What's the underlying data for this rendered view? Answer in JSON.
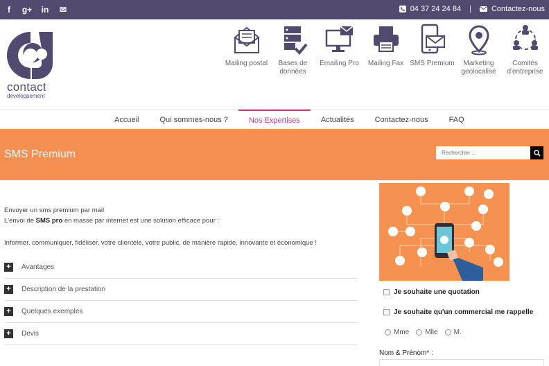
{
  "topbar": {
    "social": [
      {
        "icon": "facebook-icon",
        "glyph": "f"
      },
      {
        "icon": "google-plus-icon",
        "glyph": "g+"
      },
      {
        "icon": "linkedin-icon",
        "glyph": "in"
      },
      {
        "icon": "mail-icon",
        "glyph": "✉"
      }
    ],
    "phone": "04 37 24 24 84",
    "separator": "|",
    "contact_link": "Contactez-nous"
  },
  "logo": {
    "word": "contact",
    "sub": "développement"
  },
  "services": [
    {
      "label": "Mailing postal",
      "icon": "envelope-open-icon"
    },
    {
      "label": "Bases de données",
      "icon": "database-check-icon"
    },
    {
      "label": "Emailing Pro",
      "icon": "monitor-mail-icon"
    },
    {
      "label": "Mailing Fax",
      "icon": "printer-icon"
    },
    {
      "label": "SMS Premium",
      "icon": "phone-mail-icon"
    },
    {
      "label": "Marketing geolocalisé",
      "icon": "map-pin-icon"
    },
    {
      "label": "Comités d'entreprise",
      "icon": "people-network-icon"
    }
  ],
  "nav": [
    "Accueil",
    "Qui sommes-nous ?",
    "Nos Expertises",
    "Actualités",
    "Contactez-nous",
    "FAQ"
  ],
  "nav_active": "Nos Expertises",
  "banner": {
    "title": "SMS Premium"
  },
  "search": {
    "placeholder": "Rechercher ..."
  },
  "content": {
    "line1": "Envoyer un sms premium par mail",
    "line2_pre": "L'envoi de ",
    "line2_bold": "SMS pro",
    "line2_post": " en masse par internet est une solution efficace pour :",
    "line3": "Informer, communiquer, fidéliser, votre clientèle, votre public, de manière rapide, innovante et économique !"
  },
  "accordion": [
    {
      "label": "Avantages",
      "glyph": "+"
    },
    {
      "label": "Description de la prestation",
      "glyph": "+"
    },
    {
      "label": "Quelques exemples",
      "glyph": "+"
    },
    {
      "label": "Devis",
      "glyph": "+"
    }
  ],
  "form": {
    "check1": "Je souhaite une quotation",
    "check2": "Je souhaite qu'un commercial me rappelle",
    "radios": [
      "Mme",
      "Mlle",
      "M."
    ],
    "name_label": "Nom & Prénom* :"
  },
  "colors": {
    "topbar": "#524a6e",
    "accent": "#d6337e",
    "banner": "#f58f52"
  }
}
